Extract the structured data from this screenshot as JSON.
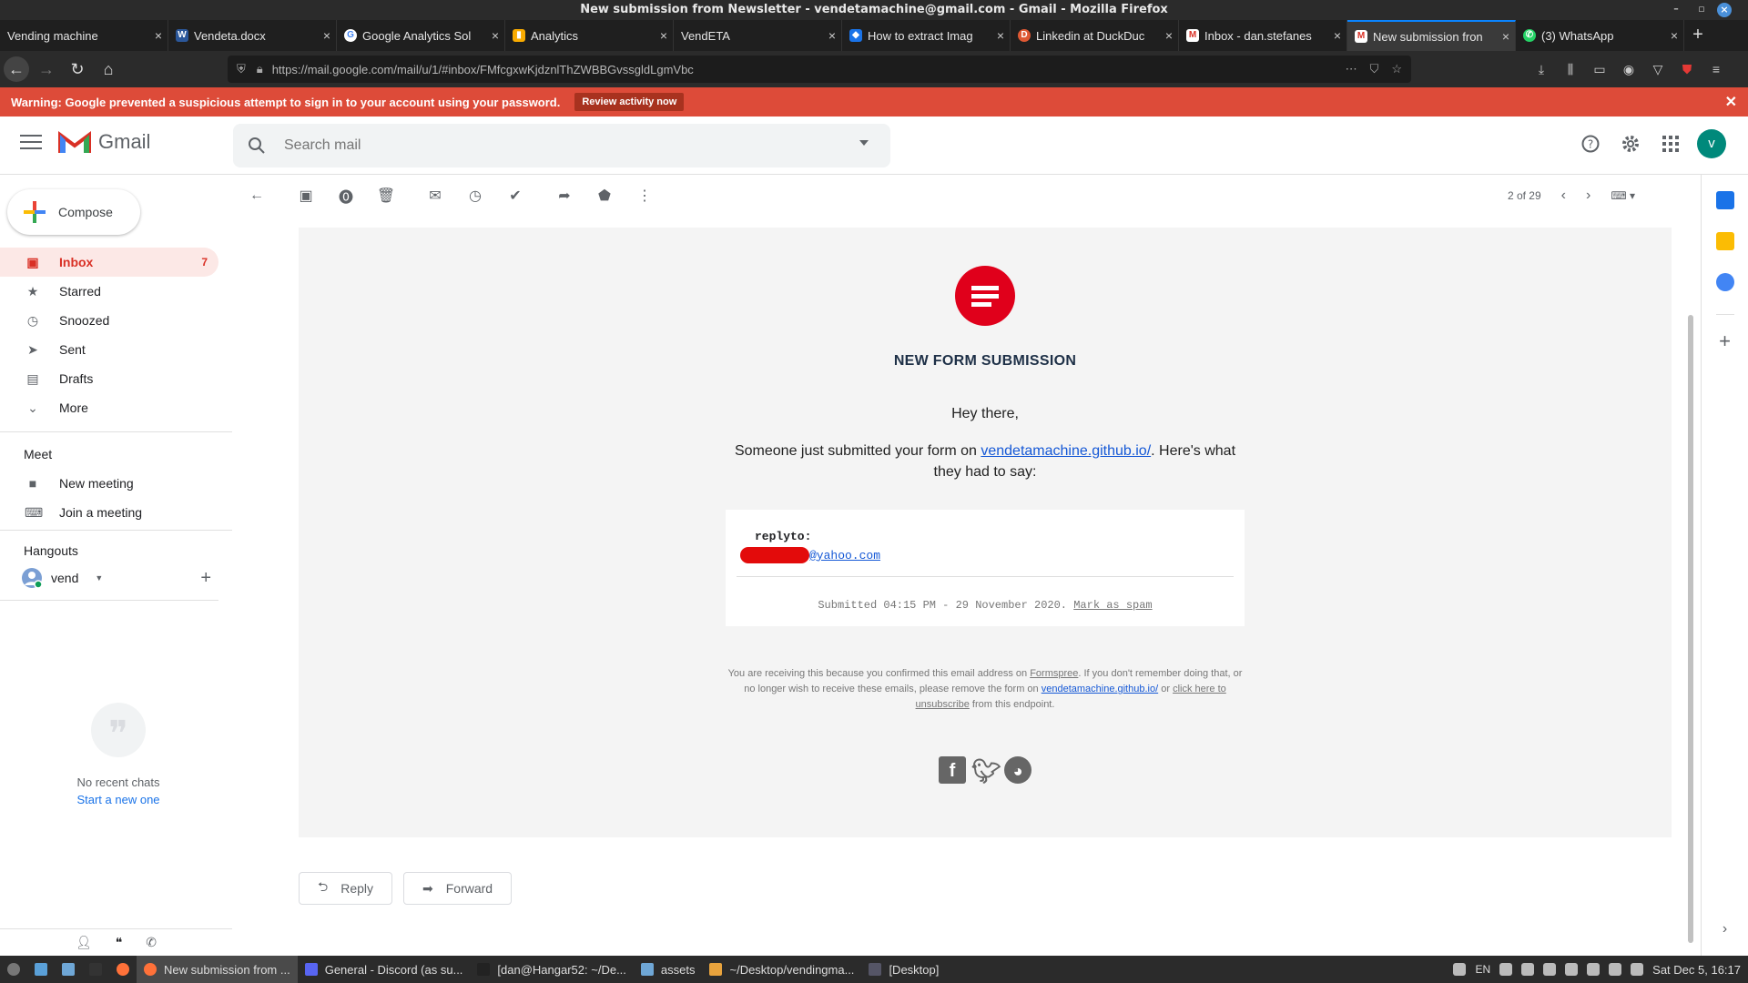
{
  "window": {
    "title": "New submission from Newsletter - vendetamachine@gmail.com - Gmail - Mozilla Firefox"
  },
  "tabs": [
    {
      "label": "Vending machine",
      "icon": "blank-page-icon"
    },
    {
      "label": "Vendeta.docx",
      "icon": "word-icon"
    },
    {
      "label": "Google Analytics Sol",
      "icon": "google-icon"
    },
    {
      "label": "Analytics",
      "icon": "analytics-icon"
    },
    {
      "label": "VendETA",
      "icon": "blank-page-icon"
    },
    {
      "label": "How to extract Imag",
      "icon": "bookmark-icon"
    },
    {
      "label": "Linkedin at DuckDuc",
      "icon": "duckduckgo-icon"
    },
    {
      "label": "Inbox - dan.stefanes",
      "icon": "gmail-icon"
    },
    {
      "label": "New submission fron",
      "icon": "gmail-icon"
    },
    {
      "label": "(3) WhatsApp",
      "icon": "whatsapp-icon"
    }
  ],
  "urlbar": {
    "url": "https://mail.google.com/mail/u/1/#inbox/FMfcgxwKjdznlThZWBBGvssgldLgmVbc"
  },
  "warning": {
    "text": "Warning: Google prevented a suspicious attempt to sign in to your account using your password.",
    "button": "Review activity now"
  },
  "header": {
    "app_name": "Gmail",
    "search_placeholder": "Search mail",
    "avatar_letter": "v"
  },
  "sidebar": {
    "compose": "Compose",
    "items": [
      {
        "label": "Inbox",
        "count": "7",
        "icon": "inbox-icon"
      },
      {
        "label": "Starred",
        "count": "",
        "icon": "star-icon"
      },
      {
        "label": "Snoozed",
        "count": "",
        "icon": "clock-icon"
      },
      {
        "label": "Sent",
        "count": "",
        "icon": "send-icon"
      },
      {
        "label": "Drafts",
        "count": "",
        "icon": "draft-icon"
      },
      {
        "label": "More",
        "count": "",
        "icon": "chevron-down-icon"
      }
    ],
    "meet_heading": "Meet",
    "meet_items": [
      {
        "label": "New meeting"
      },
      {
        "label": "Join a meeting"
      }
    ],
    "hangouts_heading": "Hangouts",
    "hangouts_user": "vend",
    "no_chats": "No recent chats",
    "start_new": "Start a new one"
  },
  "toolbar": {
    "pager": "2 of 29"
  },
  "email": {
    "heading": "NEW FORM SUBMISSION",
    "greeting": "Hey there,",
    "intro_before": "Someone just submitted your form on ",
    "intro_link": "vendetamachine.github.io/",
    "intro_after": ". Here's what they had to say:",
    "field_label": "replyto:",
    "field_value_visible": "@yahoo.com",
    "submitted": "Submitted 04:15 PM - 29 November 2020.",
    "mark_spam": "Mark as spam",
    "footer_1": "You are receiving this because you confirmed this email address on ",
    "footer_formspree": "Formspree",
    "footer_2": ". If you don't remember doing that, or no longer wish to receive these emails, please remove the form on ",
    "footer_link": "vendetamachine.github.io/",
    "footer_3": " or ",
    "footer_unsub": "click here to unsubscribe",
    "footer_4": " from this endpoint."
  },
  "actions": {
    "reply": "Reply",
    "forward": "Forward"
  },
  "taskbar": {
    "items": [
      {
        "label": "New submission from ..."
      },
      {
        "label": "General - Discord (as su..."
      },
      {
        "label": "[dan@Hangar52: ~/De..."
      },
      {
        "label": "assets"
      },
      {
        "label": "~/Desktop/vendingma..."
      },
      {
        "label": "[Desktop]"
      }
    ],
    "lang": "EN",
    "clock": "Sat Dec 5, 16:17"
  },
  "colors": {
    "gmail_red": "#d93025",
    "warning_bg": "#dd4b39",
    "formspree_red": "#e0001b",
    "link_blue": "#1558d6"
  }
}
